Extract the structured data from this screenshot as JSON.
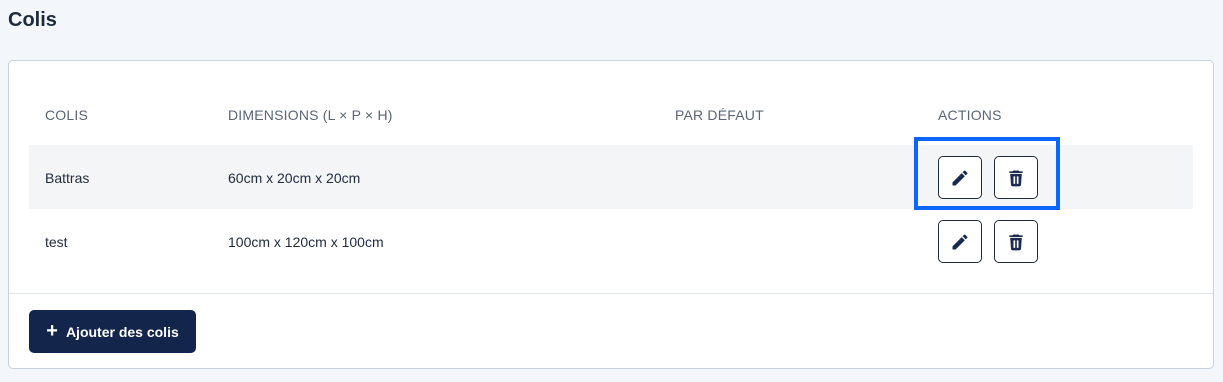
{
  "page": {
    "title": "Colis"
  },
  "table": {
    "headers": [
      "COLIS",
      "DIMENSIONS (L × P × H)",
      "PAR DÉFAUT",
      "ACTIONS"
    ],
    "rows": [
      {
        "name": "Battras",
        "dimensions": "60cm x 20cm x 20cm",
        "default": ""
      },
      {
        "name": "test",
        "dimensions": "100cm x 120cm x 100cm",
        "default": ""
      }
    ],
    "action_icons": [
      "pencil-icon",
      "trash-icon"
    ]
  },
  "add_button": {
    "label": "Ajouter des colis",
    "icon": "plus-icon"
  },
  "colors": {
    "accent": "#14254c",
    "highlight": "#0a66ff",
    "row_stripe": "#f4f5f7"
  }
}
